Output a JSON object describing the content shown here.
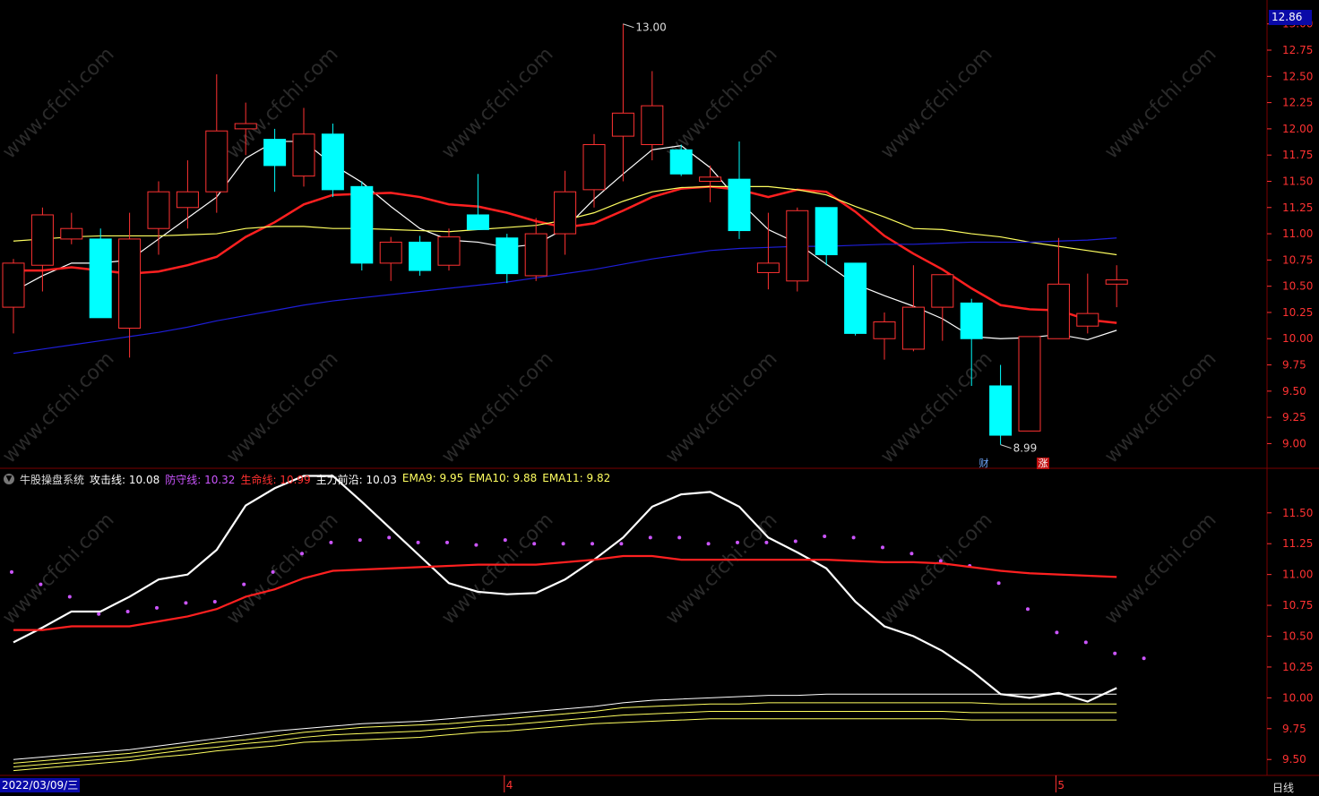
{
  "legend": {
    "title": "牛股操盘系统",
    "items": [
      {
        "label": "攻击线:",
        "value": "10.08",
        "color": "#ffffff"
      },
      {
        "label": "防守线:",
        "value": "10.32",
        "color": "#cc55ff"
      },
      {
        "label": "生命线:",
        "value": "10.99",
        "color": "#ff3030"
      },
      {
        "label": "主力前沿:",
        "value": "10.03",
        "color": "#ffffff"
      },
      {
        "label": "EMA9:",
        "value": "9.95",
        "color": "#ffff60"
      },
      {
        "label": "EMA10:",
        "value": "9.88",
        "color": "#ffff60"
      },
      {
        "label": "EMA11:",
        "value": "9.82",
        "color": "#ffff60"
      }
    ]
  },
  "current_price": "12.86",
  "cursor_date": "2022/03/09/三",
  "period": "日线",
  "badges": {
    "cai": "财",
    "zhang": "涨"
  },
  "watermark": "www.cfchi.com",
  "colors": {
    "bg": "#000000",
    "up": "#ff3232",
    "down": "#00ffff",
    "grid": "#7a0000",
    "axis_text": "#ff3232"
  },
  "chart_data": [
    {
      "type": "candlestick",
      "y_ticks": [
        "9.00",
        "9.25",
        "9.50",
        "9.75",
        "10.00",
        "10.25",
        "10.50",
        "10.75",
        "11.00",
        "11.25",
        "11.50",
        "11.75",
        "12.00",
        "12.25",
        "12.50",
        "12.75",
        "13.00"
      ],
      "ylim": [
        8.85,
        13.1
      ],
      "x_labels": [
        {
          "index": 17,
          "label": "4"
        },
        {
          "index": 36,
          "label": "5"
        }
      ],
      "annotations": [
        {
          "index": 21,
          "value": 13.0,
          "label": "13.00"
        },
        {
          "index": 34,
          "value": 8.99,
          "label": "8.99"
        }
      ],
      "candles": [
        {
          "o": 10.3,
          "h": 10.76,
          "l": 10.05,
          "c": 10.72
        },
        {
          "o": 10.7,
          "h": 11.25,
          "l": 10.45,
          "c": 11.18
        },
        {
          "o": 10.95,
          "h": 11.2,
          "l": 10.9,
          "c": 11.05
        },
        {
          "o": 10.95,
          "h": 11.05,
          "l": 10.2,
          "c": 10.2
        },
        {
          "o": 10.1,
          "h": 11.2,
          "l": 9.82,
          "c": 10.95
        },
        {
          "o": 11.05,
          "h": 11.5,
          "l": 10.8,
          "c": 11.4
        },
        {
          "o": 11.25,
          "h": 11.7,
          "l": 11.05,
          "c": 11.4
        },
        {
          "o": 11.4,
          "h": 12.52,
          "l": 11.2,
          "c": 11.98
        },
        {
          "o": 12.0,
          "h": 12.25,
          "l": 11.75,
          "c": 12.05
        },
        {
          "o": 11.9,
          "h": 12.0,
          "l": 11.4,
          "c": 11.65
        },
        {
          "o": 11.55,
          "h": 12.2,
          "l": 11.45,
          "c": 11.95
        },
        {
          "o": 11.95,
          "h": 12.05,
          "l": 11.35,
          "c": 11.42
        },
        {
          "o": 11.45,
          "h": 11.5,
          "l": 10.65,
          "c": 10.72
        },
        {
          "o": 10.72,
          "h": 10.97,
          "l": 10.55,
          "c": 10.92
        },
        {
          "o": 10.92,
          "h": 10.98,
          "l": 10.6,
          "c": 10.65
        },
        {
          "o": 10.7,
          "h": 11.05,
          "l": 10.65,
          "c": 10.97
        },
        {
          "o": 11.18,
          "h": 11.57,
          "l": 11.05,
          "c": 11.04
        },
        {
          "o": 10.96,
          "h": 11.0,
          "l": 10.53,
          "c": 10.62
        },
        {
          "o": 10.6,
          "h": 11.15,
          "l": 10.55,
          "c": 11.0
        },
        {
          "o": 11.0,
          "h": 11.6,
          "l": 10.8,
          "c": 11.4
        },
        {
          "o": 11.42,
          "h": 11.95,
          "l": 11.25,
          "c": 11.85
        },
        {
          "o": 11.93,
          "h": 13.0,
          "l": 11.5,
          "c": 12.15
        },
        {
          "o": 11.85,
          "h": 12.55,
          "l": 11.7,
          "c": 12.22
        },
        {
          "o": 11.8,
          "h": 11.85,
          "l": 11.55,
          "c": 11.57
        },
        {
          "o": 11.5,
          "h": 11.65,
          "l": 11.3,
          "c": 11.54
        },
        {
          "o": 11.52,
          "h": 11.88,
          "l": 10.95,
          "c": 11.03
        },
        {
          "o": 10.63,
          "h": 11.2,
          "l": 10.47,
          "c": 10.72
        },
        {
          "o": 10.55,
          "h": 11.25,
          "l": 10.45,
          "c": 11.22
        },
        {
          "o": 11.25,
          "h": 11.25,
          "l": 10.7,
          "c": 10.8
        },
        {
          "o": 10.72,
          "h": 10.72,
          "l": 10.03,
          "c": 10.05
        },
        {
          "o": 10.0,
          "h": 10.25,
          "l": 9.8,
          "c": 10.16
        },
        {
          "o": 9.9,
          "h": 10.7,
          "l": 9.88,
          "c": 10.3
        },
        {
          "o": 10.3,
          "h": 10.6,
          "l": 9.98,
          "c": 10.61
        },
        {
          "o": 10.34,
          "h": 10.38,
          "l": 9.55,
          "c": 10.0
        },
        {
          "o": 9.55,
          "h": 9.75,
          "l": 8.99,
          "c": 9.08
        },
        {
          "o": 9.12,
          "h": 10.02,
          "l": 9.12,
          "c": 10.02
        },
        {
          "o": 10.0,
          "h": 10.96,
          "l": 10.0,
          "c": 10.52
        },
        {
          "o": 10.12,
          "h": 10.62,
          "l": 10.05,
          "c": 10.24
        },
        {
          "o": 10.52,
          "h": 10.7,
          "l": 10.3,
          "c": 10.56
        }
      ],
      "series": [
        {
          "color": "#ffffff",
          "values": [
            10.45,
            10.6,
            10.72,
            10.72,
            10.75,
            10.95,
            11.15,
            11.35,
            11.72,
            11.88,
            11.88,
            11.66,
            11.49,
            11.26,
            11.05,
            10.94,
            10.92,
            10.87,
            10.9,
            11.05,
            11.33,
            11.57,
            11.8,
            11.84,
            11.63,
            11.31,
            11.04,
            10.91,
            10.71,
            10.52,
            10.41,
            10.31,
            10.19,
            10.02,
            10.0,
            10.01,
            10.04,
            9.99,
            10.08
          ]
        },
        {
          "color": "#ff2020",
          "values": [
            10.65,
            10.65,
            10.68,
            10.65,
            10.62,
            10.64,
            10.7,
            10.78,
            10.97,
            11.11,
            11.28,
            11.37,
            11.38,
            11.39,
            11.35,
            11.28,
            11.26,
            11.2,
            11.12,
            11.06,
            11.1,
            11.22,
            11.35,
            11.43,
            11.45,
            11.42,
            11.35,
            11.42,
            11.4,
            11.21,
            10.98,
            10.81,
            10.66,
            10.48,
            10.32,
            10.28,
            10.27,
            10.18,
            10.15
          ]
        },
        {
          "color": "#ffff60",
          "values": [
            10.93,
            10.95,
            10.97,
            10.98,
            10.98,
            10.98,
            10.99,
            11.0,
            11.05,
            11.07,
            11.07,
            11.05,
            11.05,
            11.04,
            11.03,
            11.02,
            11.04,
            11.06,
            11.08,
            11.13,
            11.2,
            11.31,
            11.4,
            11.44,
            11.45,
            11.45,
            11.45,
            11.42,
            11.37,
            11.26,
            11.16,
            11.05,
            11.04,
            11.0,
            10.97,
            10.92,
            10.88,
            10.84,
            10.8
          ]
        },
        {
          "color": "#1e1ed8",
          "values": [
            9.86,
            9.9,
            9.94,
            9.98,
            10.02,
            10.06,
            10.11,
            10.17,
            10.22,
            10.27,
            10.32,
            10.36,
            10.39,
            10.42,
            10.45,
            10.48,
            10.51,
            10.54,
            10.58,
            10.62,
            10.66,
            10.71,
            10.76,
            10.8,
            10.84,
            10.86,
            10.87,
            10.88,
            10.88,
            10.89,
            10.9,
            10.9,
            10.91,
            10.92,
            10.92,
            10.92,
            10.93,
            10.94,
            10.96
          ]
        }
      ]
    },
    {
      "type": "line",
      "title": "牛股操盘系统",
      "y_ticks": [
        "9.50",
        "9.75",
        "10.00",
        "10.25",
        "10.50",
        "10.75",
        "11.00",
        "11.25",
        "11.50"
      ],
      "ylim": [
        9.4,
        11.68
      ],
      "series": [
        {
          "name": "攻击线",
          "color": "#ffffff",
          "values": [
            10.45,
            10.57,
            10.7,
            10.7,
            10.82,
            10.96,
            11.0,
            11.2,
            11.56,
            11.7,
            11.8,
            11.8,
            11.59,
            11.37,
            11.15,
            10.93,
            10.86,
            10.84,
            10.85,
            10.96,
            11.12,
            11.3,
            11.55,
            11.65,
            11.67,
            11.55,
            11.3,
            11.18,
            11.05,
            10.78,
            10.58,
            10.5,
            10.38,
            10.22,
            10.03,
            10.0,
            10.04,
            9.97,
            10.08
          ]
        },
        {
          "name": "防守线",
          "color": "#cc55ff",
          "style": "dots",
          "values": [
            11.02,
            10.92,
            10.82,
            10.68,
            10.7,
            10.73,
            10.77,
            10.78,
            10.92,
            11.02,
            11.17,
            11.26,
            11.28,
            11.3,
            11.26,
            11.26,
            11.24,
            11.28,
            11.25,
            11.25,
            11.25,
            11.25,
            11.3,
            11.3,
            11.25,
            11.26,
            11.26,
            11.27,
            11.31,
            11.3,
            11.22,
            11.17,
            11.11,
            11.07,
            10.93,
            10.72,
            10.53,
            10.45,
            10.36,
            10.32
          ]
        },
        {
          "name": "生命线",
          "color": "#ff2020",
          "values": [
            10.55,
            10.55,
            10.58,
            10.58,
            10.58,
            10.62,
            10.66,
            10.72,
            10.82,
            10.88,
            10.97,
            11.03,
            11.04,
            11.05,
            11.06,
            11.07,
            11.08,
            11.08,
            11.08,
            11.1,
            11.12,
            11.15,
            11.15,
            11.12,
            11.12,
            11.12,
            11.12,
            11.12,
            11.12,
            11.11,
            11.1,
            11.1,
            11.09,
            11.06,
            11.03,
            11.01,
            11.0,
            10.99,
            10.98
          ]
        },
        {
          "name": "主力前沿",
          "color": "#ffffff",
          "values": [
            9.5,
            9.52,
            9.54,
            9.56,
            9.58,
            9.61,
            9.64,
            9.67,
            9.7,
            9.73,
            9.75,
            9.77,
            9.79,
            9.8,
            9.81,
            9.83,
            9.85,
            9.87,
            9.89,
            9.91,
            9.93,
            9.96,
            9.98,
            9.99,
            10.0,
            10.01,
            10.02,
            10.02,
            10.03,
            10.03,
            10.03,
            10.03,
            10.03,
            10.03,
            10.03,
            10.03,
            10.03,
            10.03,
            10.03
          ]
        },
        {
          "name": "EMA9",
          "color": "#ffff60",
          "values": [
            9.47,
            9.49,
            9.51,
            9.53,
            9.55,
            9.58,
            9.61,
            9.64,
            9.66,
            9.69,
            9.72,
            9.74,
            9.76,
            9.77,
            9.78,
            9.79,
            9.81,
            9.83,
            9.85,
            9.87,
            9.89,
            9.92,
            9.93,
            9.94,
            9.95,
            9.95,
            9.96,
            9.96,
            9.96,
            9.96,
            9.96,
            9.96,
            9.96,
            9.96,
            9.95,
            9.95,
            9.95,
            9.95,
            9.95
          ]
        },
        {
          "name": "EMA10",
          "color": "#ffff60",
          "values": [
            9.44,
            9.46,
            9.48,
            9.5,
            9.52,
            9.55,
            9.58,
            9.6,
            9.63,
            9.65,
            9.68,
            9.7,
            9.71,
            9.72,
            9.73,
            9.75,
            9.77,
            9.78,
            9.8,
            9.82,
            9.84,
            9.86,
            9.87,
            9.88,
            9.89,
            9.89,
            9.89,
            9.89,
            9.89,
            9.89,
            9.89,
            9.89,
            9.89,
            9.88,
            9.88,
            9.88,
            9.88,
            9.88,
            9.88
          ]
        },
        {
          "name": "EMA11",
          "color": "#ffff60",
          "values": [
            9.41,
            9.43,
            9.45,
            9.47,
            9.49,
            9.52,
            9.54,
            9.57,
            9.59,
            9.61,
            9.64,
            9.65,
            9.66,
            9.67,
            9.68,
            9.7,
            9.72,
            9.73,
            9.75,
            9.77,
            9.79,
            9.8,
            9.81,
            9.82,
            9.83,
            9.83,
            9.83,
            9.83,
            9.83,
            9.83,
            9.83,
            9.83,
            9.83,
            9.82,
            9.82,
            9.82,
            9.82,
            9.82,
            9.82
          ]
        }
      ]
    }
  ]
}
